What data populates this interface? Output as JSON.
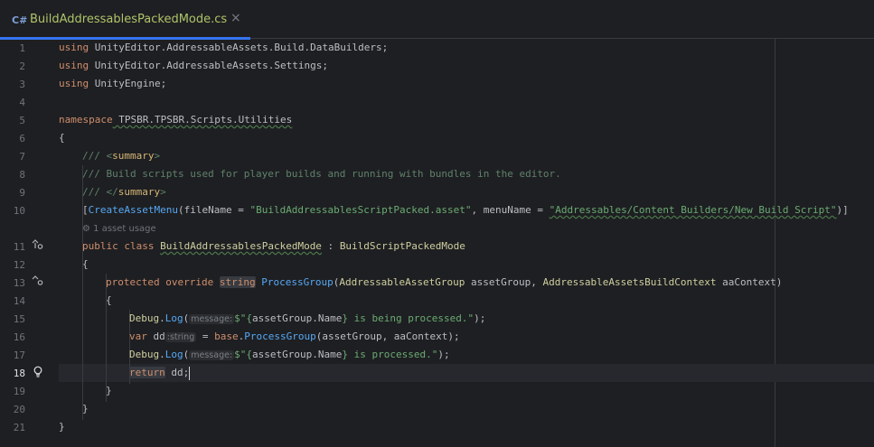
{
  "tab": {
    "lang": "C#",
    "filename": "BuildAddressablesPackedMode.cs",
    "close": "×"
  },
  "lines": [
    {
      "n": "1"
    },
    {
      "n": "2"
    },
    {
      "n": "3"
    },
    {
      "n": "4"
    },
    {
      "n": "5"
    },
    {
      "n": "6"
    },
    {
      "n": "7"
    },
    {
      "n": "8"
    },
    {
      "n": "9"
    },
    {
      "n": "10"
    },
    {
      "n": "11"
    },
    {
      "n": "12"
    },
    {
      "n": "13"
    },
    {
      "n": "14"
    },
    {
      "n": "15"
    },
    {
      "n": "16"
    },
    {
      "n": "17"
    },
    {
      "n": "18"
    },
    {
      "n": "19"
    },
    {
      "n": "20"
    },
    {
      "n": "21"
    }
  ],
  "code": {
    "l1": {
      "kw": "using",
      "rest": " UnityEditor.AddressableAssets.Build.DataBuilders;"
    },
    "l2": {
      "kw": "using",
      "rest": " UnityEditor.AddressableAssets.Settings;"
    },
    "l3": {
      "kw": "using",
      "rest": " UnityEngine;"
    },
    "l5": {
      "kw": "namespace",
      "rest": " TPSBR.TPSBR.Scripts.Utilities"
    },
    "l6": "{",
    "l7": {
      "slashes": "/// ",
      "open": "<",
      "tag": "summary",
      "close": ">"
    },
    "l8": "/// Build scripts used for player builds and running with bundles in the editor.",
    "l9": {
      "slashes": "/// ",
      "open": "</",
      "tag": "summary",
      "close": ">"
    },
    "l10": {
      "b1": "[",
      "attr": "CreateAssetMenu",
      "p1": "(fileName = ",
      "s1": "\"BuildAddressablesScriptPacked.asset\"",
      "p2": ", menuName = ",
      "s2": "\"Addressables/Content Builders/New Build Script\"",
      "p3": ")]"
    },
    "usage_hint": "1 asset usage",
    "l11": {
      "k1": "public",
      "k2": "class",
      "name": "BuildAddressablesPackedMode",
      "sep": " : ",
      "base": "BuildScriptPackedMode"
    },
    "l12": "{",
    "l13": {
      "k1": "protected",
      "k2": "override",
      "k3": "string",
      "meth": "ProcessGroup",
      "p1": "(",
      "t1": "AddressableAssetGroup",
      "a1": " assetGroup, ",
      "t2": "AddressableAssetsBuildContext",
      "a2": " aaContext)"
    },
    "l14": "{",
    "l15": {
      "cls": "Debug",
      "dot": ".",
      "meth": "Log",
      "p": "(",
      "hint": "message:",
      "pre": "$",
      "s1": "\"{",
      "expr": "assetGroup.Name",
      "s2": "} is being processed.\"",
      "end": ");"
    },
    "l16": {
      "kw": "var",
      "name": "dd",
      "hint": ":string",
      "eq": " = ",
      "kw2": "base",
      "dot": ".",
      "meth": "ProcessGroup",
      "args": "(assetGroup, aaContext);"
    },
    "l17": {
      "cls": "Debug",
      "dot": ".",
      "meth": "Log",
      "p": "(",
      "hint": "message:",
      "pre": "$",
      "s1": "\"{",
      "expr": "assetGroup.Name",
      "s2": "} is processed.\"",
      "end": ");"
    },
    "l18": {
      "kw": "return",
      "rest": " dd;"
    },
    "l19": "}",
    "l20": "}",
    "l21": "}"
  }
}
